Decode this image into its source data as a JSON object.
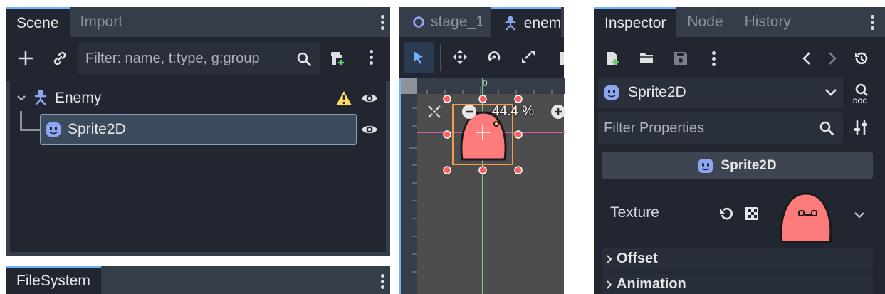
{
  "scene_dock": {
    "tabs": [
      {
        "label": "Scene",
        "active": true
      },
      {
        "label": "Import",
        "active": false
      }
    ],
    "filter_placeholder": "Filter: name, t:type, g:group",
    "tree": [
      {
        "label": "Enemy",
        "icon": "character-body-icon",
        "warning": true,
        "visible": true
      },
      {
        "label": "Sprite2D",
        "icon": "sprite2d-icon",
        "selected": true,
        "visible": true
      }
    ]
  },
  "filesystem_dock": {
    "tab_label": "FileSystem"
  },
  "viewport": {
    "tabs": [
      {
        "label": "stage_1",
        "active": false
      },
      {
        "label": "enem",
        "active": true
      }
    ],
    "zoom_label": "44.4 %",
    "ruler_zero": "0"
  },
  "inspector": {
    "tabs": [
      {
        "label": "Inspector",
        "active": true
      },
      {
        "label": "Node",
        "active": false
      },
      {
        "label": "History",
        "active": false
      }
    ],
    "object_name": "Sprite2D",
    "filter_placeholder": "Filter Properties",
    "section_title": "Sprite2D",
    "texture_label": "Texture",
    "subsections": [
      "Offset",
      "Animation"
    ]
  },
  "colors": {
    "accent": "#6db1ff",
    "panel": "#363d4a",
    "dark": "#212631",
    "blob": "#fe7b7b",
    "warning": "#ffdd65"
  }
}
